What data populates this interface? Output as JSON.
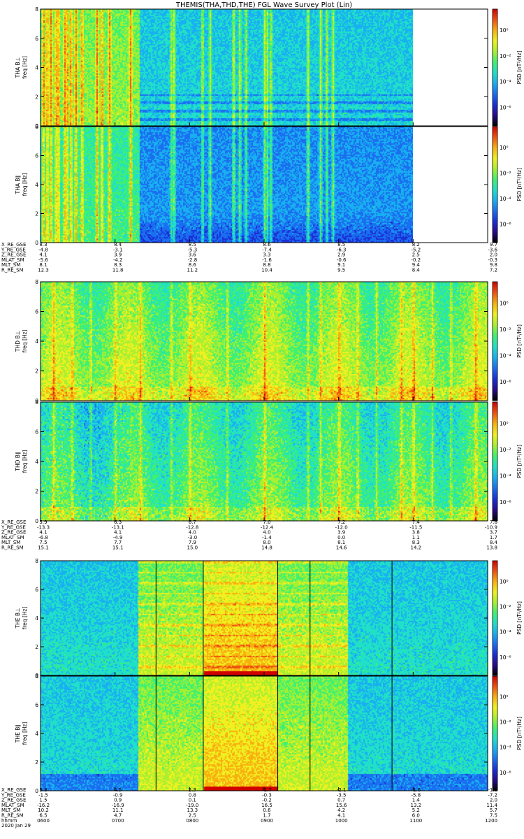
{
  "title": "THEMIS(THA,THD,THE) FGL Wave Survey Plot (Lin)",
  "colors": {
    "colormap": [
      "#000000",
      "#2a0a8a",
      "#1a2fd6",
      "#1a6ef0",
      "#18b0f0",
      "#20e0c8",
      "#40f070",
      "#a8f030",
      "#f0f020",
      "#f8b010",
      "#f05010",
      "#d00000"
    ],
    "frame": "#000000",
    "background": "#ffffff"
  },
  "colorbar": {
    "label": "PSD [nT²/Hz]",
    "tick_labels": [
      "10⁰",
      "10⁻²",
      "10⁻⁴",
      "10⁻⁶"
    ]
  },
  "freq_ticks": [
    "0",
    "2",
    "4",
    "6",
    "8"
  ],
  "chart_data": [
    {
      "type": "heatmap",
      "panel_label": "THA B⊥",
      "ylabel": "THA B⊥\nfreq [Hz]",
      "ylim": [
        0,
        8
      ],
      "x_range_hhmm": [
        "0600",
        "1200"
      ],
      "data_end_hhmm": "1100",
      "zscale": "log",
      "zlim": [
        1e-06,
        10.0
      ],
      "bursts_hhmm": [
        "0602",
        "0605",
        "0608",
        "0612",
        "0614",
        "0619",
        "0621",
        "0624",
        "0628",
        "0633",
        "0645",
        "0649",
        "0655",
        "0712",
        "0745",
        "0747",
        "0810",
        "0816",
        "0835",
        "0840",
        "0845",
        "0900",
        "0902",
        "0905",
        "0935",
        "0945",
        "0950",
        "0955"
      ]
    },
    {
      "type": "heatmap",
      "panel_label": "THA B∥",
      "ylabel": "THA B∥\nfreq [Hz]",
      "ylim": [
        0,
        8
      ],
      "x_range_hhmm": [
        "0600",
        "1200"
      ],
      "data_end_hhmm": "1100",
      "zscale": "log",
      "zlim": [
        1e-06,
        10.0
      ],
      "bursts_hhmm": [
        "0602",
        "0605",
        "0608",
        "0612",
        "0614",
        "0619",
        "0621",
        "0624",
        "0628",
        "0633",
        "0645",
        "0649",
        "0655",
        "0712",
        "0745",
        "0747",
        "0810",
        "0816",
        "0835",
        "0840",
        "0845",
        "0900",
        "0902",
        "0905",
        "0935",
        "0945",
        "0950",
        "0955"
      ]
    },
    {
      "type": "heatmap",
      "panel_label": "THD B⊥",
      "ylabel": "THD B⊥\nfreq [Hz]",
      "ylim": [
        0,
        8
      ],
      "x_range_hhmm": [
        "0600",
        "1200"
      ],
      "data_end_hhmm": "1200",
      "zscale": "log",
      "zlim": [
        1e-06,
        10.0
      ],
      "bursts_hhmm": [
        "0610",
        "0625",
        "0640",
        "0700",
        "0720",
        "0745",
        "0800",
        "0830",
        "0900",
        "0935",
        "0945",
        "1000",
        "1015",
        "1030",
        "1050",
        "1100",
        "1115",
        "1130",
        "1150"
      ]
    },
    {
      "type": "heatmap",
      "panel_label": "THD B∥",
      "ylabel": "THD B∥\nfreq [Hz]",
      "ylim": [
        0,
        8
      ],
      "x_range_hhmm": [
        "0600",
        "1200"
      ],
      "data_end_hhmm": "1200",
      "zscale": "log",
      "zlim": [
        1e-06,
        10.0
      ],
      "bursts_hhmm": [
        "0610",
        "0625",
        "0640",
        "0700",
        "0720",
        "0745",
        "0800",
        "0830",
        "0900",
        "0935",
        "0945",
        "1000",
        "1015",
        "1030",
        "1050",
        "1100",
        "1115",
        "1130",
        "1150"
      ]
    },
    {
      "type": "heatmap",
      "panel_label": "THE B⊥",
      "ylabel": "THE B⊥\nfreq [Hz]",
      "ylim": [
        0,
        8
      ],
      "x_range_hhmm": [
        "0600",
        "1200"
      ],
      "data_end_hhmm": "1200",
      "zscale": "log",
      "zlim": [
        1e-06,
        10.0
      ],
      "active_hhmm": [
        "0718",
        "1007"
      ],
      "core_hhmm": [
        "0811",
        "0911"
      ],
      "marker_lines_hhmm": [
        "0733",
        "0811",
        "0911",
        "0937",
        "1043"
      ]
    },
    {
      "type": "heatmap",
      "panel_label": "THE B∥",
      "ylabel": "THE B∥\nfreq [Hz]",
      "ylim": [
        0,
        8
      ],
      "x_range_hhmm": [
        "0600",
        "1200"
      ],
      "data_end_hhmm": "1200",
      "zscale": "log",
      "zlim": [
        1e-06,
        10.0
      ],
      "active_hhmm": [
        "0718",
        "1007"
      ],
      "core_hhmm": [
        "0811",
        "0911"
      ],
      "marker_lines_hhmm": [
        "0733",
        "0811",
        "0911",
        "0937",
        "1043"
      ]
    }
  ],
  "ephem": [
    {
      "labels": [
        "X_RE_GSE",
        "Y_RE_GSE",
        "Z_RE_GSE",
        "MLAT_SM",
        "MLT_SM",
        "R_RE_SM"
      ],
      "rows": [
        [
          "8.3",
          "8.4",
          "8.5",
          "8.6",
          "8.5",
          "8.2",
          "9.7"
        ],
        [
          "-4.8",
          "-3.1",
          "-5.3",
          "-7.4",
          "-6.3",
          "-5.2",
          "-3.6"
        ],
        [
          "4.1",
          "3.9",
          "3.6",
          "3.3",
          "2.9",
          "2.5",
          "2.0"
        ],
        [
          "-5.6",
          "-4.2",
          "-2.8",
          "-1.6",
          "-0.6",
          "-0.2",
          "-0.3"
        ],
        [
          "8.1",
          "8.3",
          "8.6",
          "8.8",
          "9.1",
          "9.4",
          "9.8"
        ],
        [
          "12.3",
          "11.8",
          "11.2",
          "10.4",
          "9.5",
          "8.4",
          "7.2"
        ]
      ]
    },
    {
      "labels": [
        "X_RE_GSE",
        "Y_RE_GSE",
        "Z_RE_GSE",
        "MLAT_SM",
        "MLT_SM",
        "R_RE_SM"
      ],
      "rows": [
        [
          "5.9",
          "6.3",
          "6.7",
          "7.0",
          "7.2",
          "7.4",
          "7.8"
        ],
        [
          "-13.3",
          "-13.1",
          "-12.8",
          "-12.4",
          "-12.0",
          "-11.5",
          "-10.9"
        ],
        [
          "4.1",
          "4.1",
          "4.0",
          "4.0",
          "3.9",
          "3.8",
          "3.7"
        ],
        [
          "-6.8",
          "-4.9",
          "-3.0",
          "-1.4",
          "0.0",
          "1.1",
          "1.7"
        ],
        [
          "7.5",
          "7.7",
          "7.9",
          "8.0",
          "8.1",
          "8.3",
          "8.4"
        ],
        [
          "15.1",
          "15.1",
          "15.0",
          "14.8",
          "14.6",
          "14.2",
          "13.8"
        ]
      ]
    },
    {
      "labels": [
        "X_RE_GSE",
        "Y_RE_GSE",
        "Z_RE_GSE",
        "MLAT_SM",
        "MLT_SM",
        "R_RE_SM",
        "hhmm",
        "2020 Jan 29"
      ],
      "rows": [
        [
          "5.8",
          "4.5",
          "2.3",
          "-1.7",
          "-2.1",
          "-1.6",
          "-1.0"
        ],
        [
          "-1.5",
          "-0.9",
          "0.8",
          "-0.3",
          "-3.5",
          "-5.8",
          "-7.2"
        ],
        [
          "1.5",
          "0.9",
          "0.1",
          "-0.2",
          "0.7",
          "1.4",
          "2.0"
        ],
        [
          "-16.2",
          "-16.9",
          "-19.0",
          "16.5",
          "15.6",
          "13.2",
          "11.4"
        ],
        [
          "10.2",
          "11.1",
          "13.3",
          "0.6",
          "4.2",
          "5.2",
          "5.7"
        ],
        [
          "6.5",
          "4.7",
          "2.5",
          "1.7",
          "4.1",
          "6.0",
          "7.5"
        ],
        [
          "0600",
          "0700",
          "0800",
          "0900",
          "1000",
          "1100",
          "1200"
        ]
      ]
    }
  ]
}
